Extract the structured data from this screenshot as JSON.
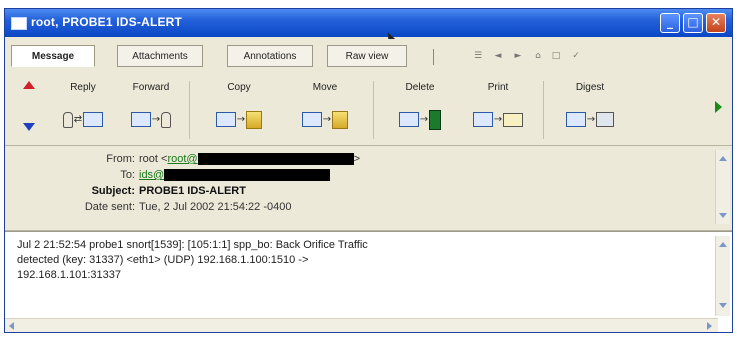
{
  "window": {
    "title": "root, PROBE1 IDS-ALERT",
    "controls": {
      "minimize": "_",
      "maximize": "□",
      "close": "✕"
    }
  },
  "tabs": [
    {
      "label": "Message",
      "active": true
    },
    {
      "label": "Attachments",
      "active": false
    },
    {
      "label": "Annotations",
      "active": false
    },
    {
      "label": "Raw view",
      "active": false
    }
  ],
  "tab_icons": [
    "☰",
    "◄",
    "►",
    "⌂",
    "□",
    "✓"
  ],
  "toolbar": {
    "reply": "Reply",
    "forward": "Forward",
    "copy": "Copy",
    "move": "Move",
    "delete": "Delete",
    "print": "Print",
    "digest": "Digest"
  },
  "header": {
    "from_label": "From:",
    "from_name": "root <",
    "from_link": "root@",
    "from_suffix": ">",
    "to_label": "To:",
    "to_link": "ids@",
    "subject_label": "Subject:",
    "subject": "PROBE1 IDS-ALERT",
    "date_label": "Date sent:",
    "date": "Tue, 2 Jul 2002 21:54:22 -0400"
  },
  "body": {
    "text": "Jul 2 21:52:54 probe1 snort[1539]: [105:1:1] spp_bo: Back Orifice Traffic\ndetected (key: 31337) <eth1> (UDP) 192.168.1.100:1510 ->\n192.168.1.101:31337"
  },
  "colors": {
    "title_bar": "#0a47c4",
    "link": "#1a7a1a",
    "up_arrow": "#d0202a",
    "down_arrow": "#2040c0"
  }
}
